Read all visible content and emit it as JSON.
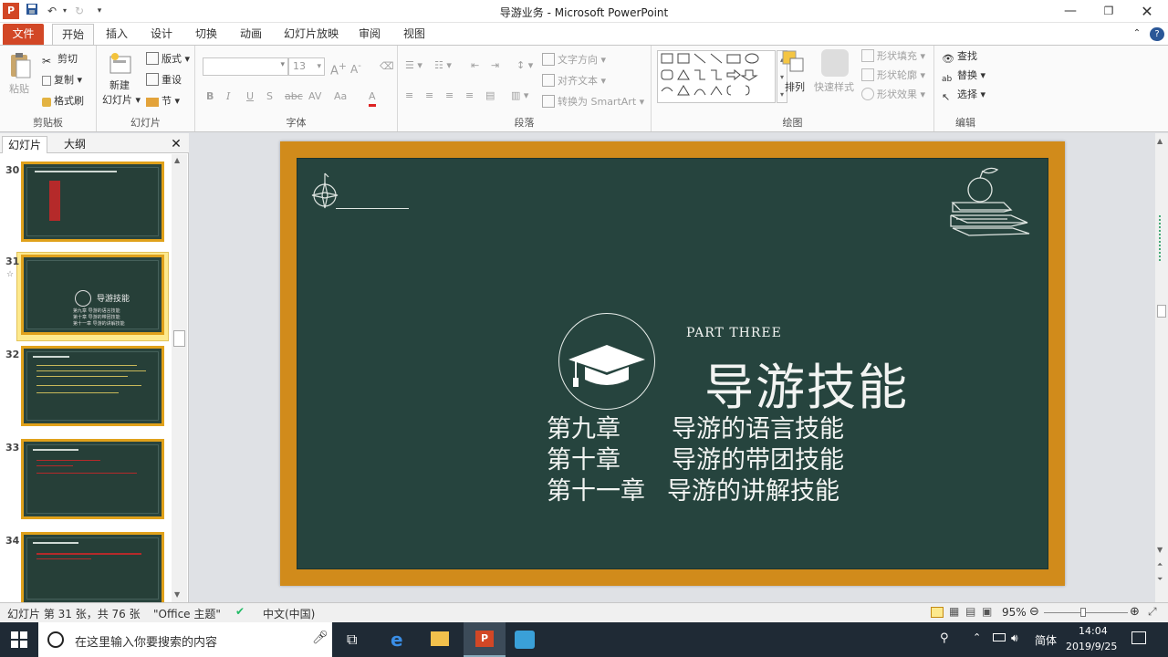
{
  "window": {
    "title": "导游业务  -  Microsoft PowerPoint"
  },
  "tabs": [
    "文件",
    "开始",
    "插入",
    "设计",
    "切换",
    "动画",
    "幻灯片放映",
    "审阅",
    "视图"
  ],
  "ribbon": {
    "clipboard": {
      "paste": "粘贴",
      "cut": "剪切",
      "copy": "复制",
      "painter": "格式刷",
      "label": "剪贴板"
    },
    "slides": {
      "new_slide": "新建",
      "new_slide2": "幻灯片",
      "layout": "版式",
      "reset": "重设",
      "section": "节",
      "label": "幻灯片"
    },
    "font": {
      "size": "13",
      "bold": "B",
      "italic": "I",
      "underline": "U",
      "shadow": "S",
      "strike": "abc",
      "spacing": "AV",
      "case": "Aa",
      "color": "A",
      "label": "字体"
    },
    "paragraph": {
      "text_direction": "文字方向",
      "align_text": "对齐文本",
      "smartart": "转换为 SmartArt",
      "label": "段落"
    },
    "drawing": {
      "arrange": "排列",
      "quick_styles": "快速样式",
      "fill": "形状填充",
      "outline": "形状轮廓",
      "effects": "形状效果",
      "label": "绘图"
    },
    "editing": {
      "find": "查找",
      "replace": "替换",
      "select": "选择",
      "label": "编辑"
    }
  },
  "pane": {
    "tab_slides": "幻灯片",
    "tab_outline": "大纲"
  },
  "thumbnails": [
    {
      "num": "30"
    },
    {
      "num": "31",
      "title": "导游技能",
      "lines": [
        "第九章  导游的语言技能",
        "第十章  导游的带团技能",
        "第十一章 导游的讲解技能"
      ]
    },
    {
      "num": "32"
    },
    {
      "num": "33"
    },
    {
      "num": "34"
    }
  ],
  "slide": {
    "part": "PART THREE",
    "title": "导游技能",
    "chapters": [
      {
        "ch": "第九章",
        "name": "导游的语言技能"
      },
      {
        "ch": "第十章",
        "name": "导游的带团技能"
      },
      {
        "ch": "第十一章",
        "name": "导游的讲解技能"
      }
    ]
  },
  "status": {
    "slide_info": "幻灯片 第 31 张，共 76 张",
    "theme": "\"Office 主题\"",
    "lang": "中文(中国)",
    "zoom": "95%"
  },
  "taskbar": {
    "search_placeholder": "在这里输入你要搜索的内容",
    "ime": "简体",
    "time": "14:04",
    "date": "2019/9/25"
  },
  "colors": {
    "board": "#26443e",
    "frame": "#d18b1b",
    "file_tab": "#d24726",
    "selection": "#fde98d"
  }
}
